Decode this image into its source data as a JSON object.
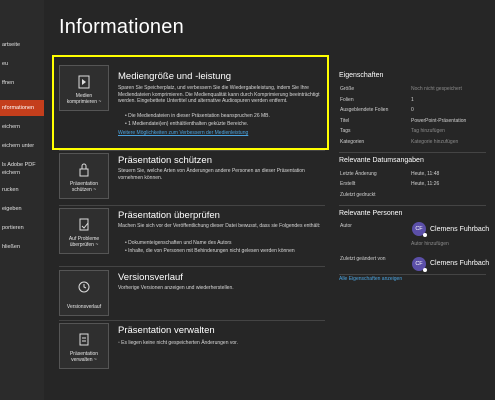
{
  "sidebar": {
    "items": [
      {
        "label": "artseite"
      },
      {
        "label": "eu"
      },
      {
        "label": "ffnen"
      },
      {
        "label": "nformationen"
      },
      {
        "label": "eichern"
      },
      {
        "label": "eichern unter"
      },
      {
        "label": "ls Adobe PDF"
      },
      {
        "label": "eichern"
      },
      {
        "label": "rucken"
      },
      {
        "label": "eigeben"
      },
      {
        "label": "portieren"
      },
      {
        "label": "hließen"
      }
    ]
  },
  "page": {
    "title": "Informationen"
  },
  "media": {
    "tile_label_line1": "Medien",
    "tile_label_line2": "komprimieren ~",
    "title": "Mediengröße und -leistung",
    "text": "Sparen Sie Speicherplatz, und verbessern Sie die Wiedergabeleistung, indem Sie Ihre Mediendateien komprimieren. Die Medienqualität kann durch Komprimierung beeinträchtigt werden. Eingebettete Untertitel und alternative Audiospuren werden entfernt.",
    "bullets": [
      "Die Mediendateien in dieser Präsentation beanspruchen 26 MB.",
      "1 Mediendatei(en) enthält/enthalten geküzte Bereiche."
    ],
    "link": "Weitere Möglichkeiten zum Verbessern der Medienleistung"
  },
  "protect": {
    "tile_label_line1": "Präsentation",
    "tile_label_line2": "schützen ~",
    "title": "Präsentation schützen",
    "text": "Steuern Sie, welche Arten von Änderungen andere Personen an dieser Präsentation vornehmen können."
  },
  "inspect": {
    "tile_label_line1": "Auf Probleme",
    "tile_label_line2": "überprüfen ~",
    "title": "Präsentation überprüfen",
    "text": "Machen Sie sich vor der Veröffentlichung dieser Datei bewusst, dass sie Folgendes enthält:",
    "bullets": [
      "Dokumenteigenschaften und Name des Autors",
      "Inhalte, die von Personen mit Behinderungen nicht gelesen werden können"
    ]
  },
  "history": {
    "tile_label_line1": "Versionsverlauf",
    "title": "Versionsverlauf",
    "text": "Vorherige Versionen anzeigen und wiederherstellen."
  },
  "manage": {
    "tile_label_line1": "Präsentation",
    "tile_label_line2": "verwalten ~",
    "title": "Präsentation verwalten",
    "text": "Es liegen keine nicht gespeicherten Änderungen vor."
  },
  "properties": {
    "heading": "Eigenschaften",
    "rows": [
      {
        "key": "Größe",
        "value": "Noch nicht gespeichert"
      },
      {
        "key": "Folien",
        "value": "1"
      },
      {
        "key": "Ausgeblendete Folien",
        "value": "0"
      },
      {
        "key": "Titel",
        "value": "PowerPoint-Präsentation"
      },
      {
        "key": "Tags",
        "value": "Tag hinzufügen"
      },
      {
        "key": "Kategorien",
        "value": "Kategorie hinzufügen"
      }
    ]
  },
  "dates": {
    "heading": "Relevante Datumsangaben",
    "rows": [
      {
        "key": "Letzte Änderung",
        "value": "Heute, 11:48"
      },
      {
        "key": "Erstellt",
        "value": "Heute, 11:26"
      },
      {
        "key": "Zuletzt gedruckt",
        "value": ""
      }
    ]
  },
  "people": {
    "heading": "Relevante Personen",
    "author_key": "Autor",
    "author_initials": "CF",
    "author_name": "Clemens Fuhrbach",
    "add_author": "Autor hinzufügen",
    "modified_key": "Zuletzt geändert von",
    "modified_initials": "CF",
    "modified_name": "Clemens Fuhrbach",
    "all_properties_link": "Alle Eigenschaften anzeigen"
  },
  "colors": {
    "accent": "#c43e1c",
    "highlight": "#ffff00",
    "link": "#4aa3df",
    "avatar": "#5b4fa8"
  }
}
